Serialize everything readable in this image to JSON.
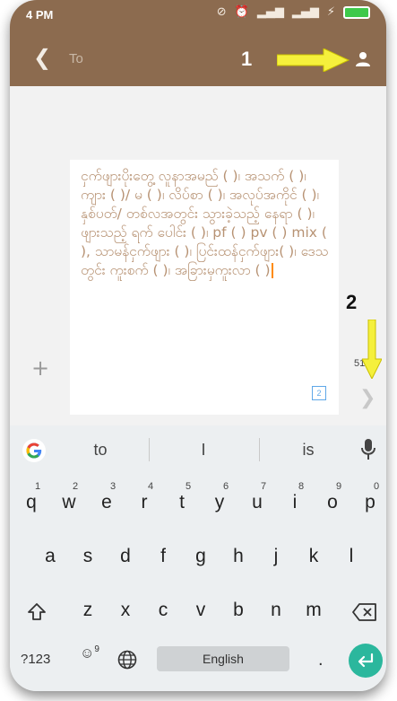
{
  "status_bar": {
    "time": "4 PM"
  },
  "header": {
    "to_placeholder": "To"
  },
  "annotations": {
    "label_1": "1",
    "label_2": "2"
  },
  "message": {
    "text": "ငှက်ဖျားပိုးတွေ့ လူနာအမည် ( )၊ အသက် ( )၊ ကျား ( )/ မ ( )၊ လိပ်စာ ( )၊ အလုပ်အကိုင် ( )၊ နှစ်ပတ်/ တစ်လအတွင်း သွားခဲ့သည့် နေရာ ( )၊ ဖျားသည့် ရက် ပေါင်း ( )၊ pf ( ) pv ( ) mix ( ), သာမန်ငှက်ဖျား ( )၊ ပြင်းထန်ငှက်ဖျား( )၊ ဒေသ တွင်း ကူးစက် ( )၊ အခြားမှကူးလာ ( )",
    "char_counter": "51",
    "sim_badge": "2"
  },
  "keyboard": {
    "suggestions": [
      "to",
      "I",
      "is"
    ],
    "row1": [
      {
        "key": "q",
        "hint": "1"
      },
      {
        "key": "w",
        "hint": "2"
      },
      {
        "key": "e",
        "hint": "3"
      },
      {
        "key": "r",
        "hint": "4"
      },
      {
        "key": "t",
        "hint": "5"
      },
      {
        "key": "y",
        "hint": "6"
      },
      {
        "key": "u",
        "hint": "7"
      },
      {
        "key": "i",
        "hint": "8"
      },
      {
        "key": "o",
        "hint": "9"
      },
      {
        "key": "p",
        "hint": "0"
      }
    ],
    "row2": [
      "a",
      "s",
      "d",
      "f",
      "g",
      "h",
      "j",
      "k",
      "l"
    ],
    "row3": [
      "z",
      "x",
      "c",
      "v",
      "b",
      "n",
      "m"
    ],
    "symbols_key": "?123",
    "emoji_hint": "9",
    "space_label": "English",
    "period_key": "."
  },
  "colors": {
    "appbar": "#8c6b4f",
    "message_text": "#b79273",
    "annotation_arrow": "#f5f03c",
    "enter_key": "#2bb79d",
    "caret": "#ff8a00"
  }
}
